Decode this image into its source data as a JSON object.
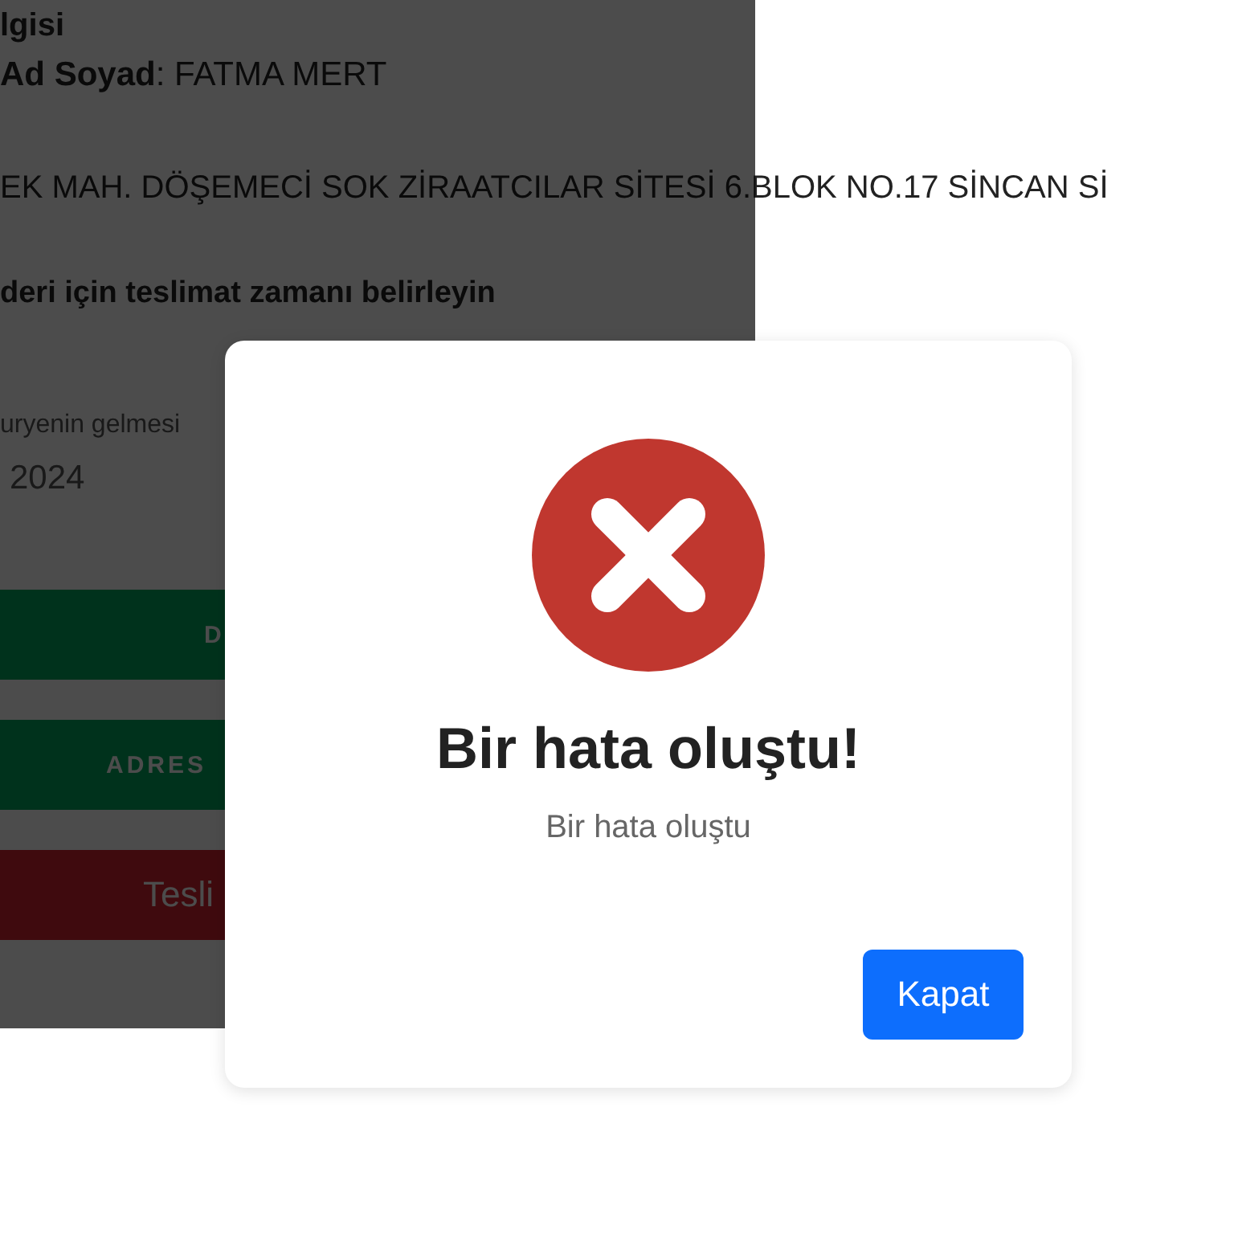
{
  "background_page": {
    "section_title": "lgisi",
    "name_line": "**Ad Soyad**: FATMA MERT",
    "address": "EK MAH. DÖŞEMECİ SOK ZİRAATCILAR SİTESİ 6.BLOK NO.17 SİNCAN Sİ",
    "delivery_heading": "deri için teslimat zamanı belirleyin",
    "courier_hint": "uryenin gelmesi",
    "date_value": "2024",
    "buttons": [
      {
        "label": "D",
        "kind": "confirm"
      },
      {
        "label": "ADRES",
        "kind": "confirm"
      },
      {
        "label": "Tesli",
        "kind": "cancel"
      }
    ]
  },
  "dialog": {
    "kind": "error",
    "title": "Bir hata oluştu!",
    "message": "Bir hata oluştu",
    "button": "Kapat"
  }
}
